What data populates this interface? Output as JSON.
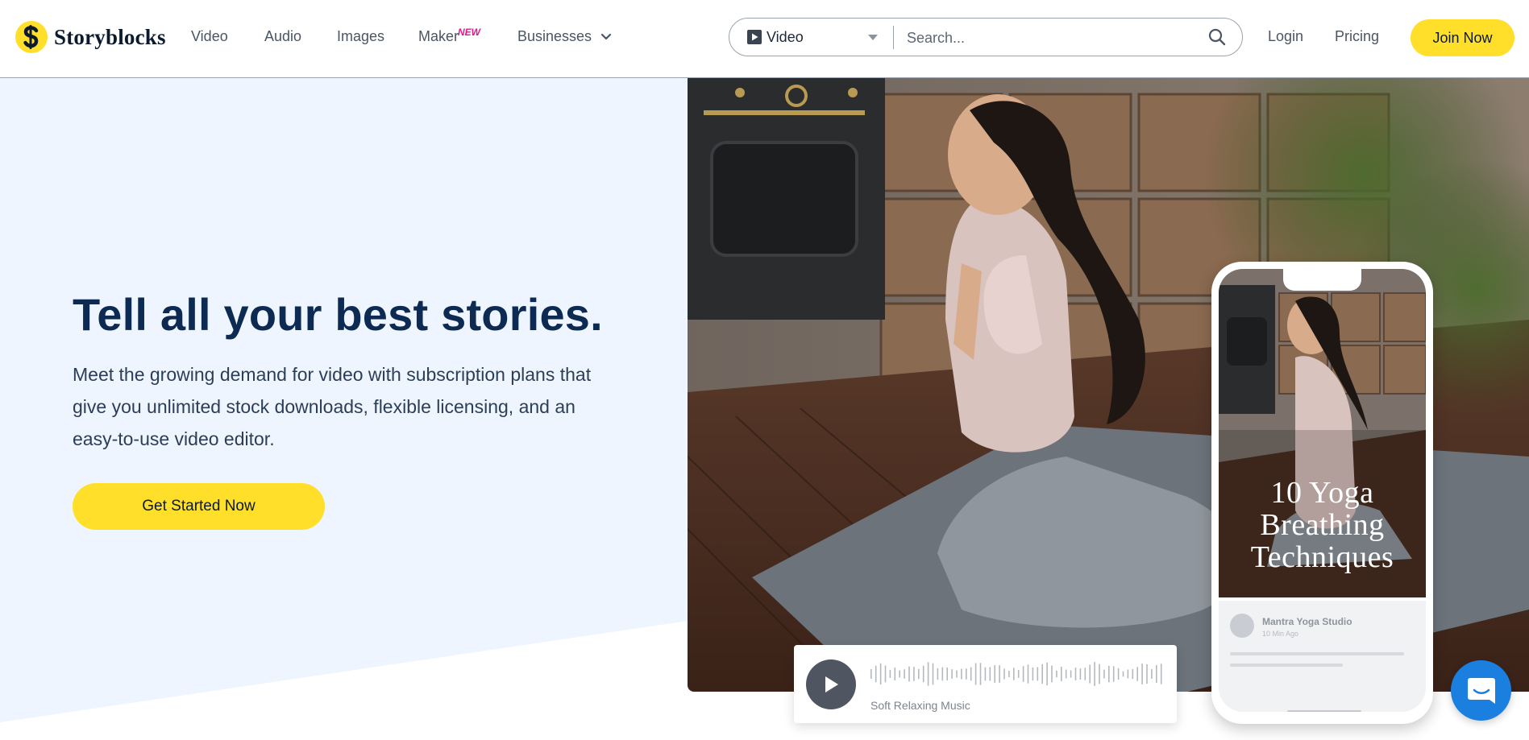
{
  "brand": {
    "name": "Storyblocks"
  },
  "nav": {
    "video": "Video",
    "audio": "Audio",
    "images": "Images",
    "maker": "Maker",
    "maker_badge": "NEW",
    "businesses": "Businesses"
  },
  "search": {
    "type_label": "Video",
    "placeholder": "Search..."
  },
  "auth": {
    "login": "Login",
    "pricing": "Pricing",
    "join": "Join Now"
  },
  "hero": {
    "headline": "Tell all your best stories.",
    "subtext": "Meet the growing demand for video with subscription plans that give you unlimited stock downloads, flexible licensing, and an easy-to-use video editor.",
    "cta": "Get Started Now"
  },
  "audio_player": {
    "track": "Soft Relaxing Music"
  },
  "phone_post": {
    "title": "10 Yoga Breathing Techniques",
    "author": "Mantra Yoga Studio",
    "time": "10 Min Ago"
  },
  "colors": {
    "accent_yellow": "#ffdf29",
    "headline_navy": "#0d2a52",
    "hero_background": "#eef5fe",
    "new_badge_pink": "#e0198a",
    "chat_blue": "#1b7fe0"
  },
  "icons": {
    "logo": "storyblocks-s-logo",
    "dropdown": "chevron-down-icon",
    "video_type": "play-square-icon",
    "search": "search-icon",
    "play": "play-icon",
    "chat": "chat-icon"
  }
}
